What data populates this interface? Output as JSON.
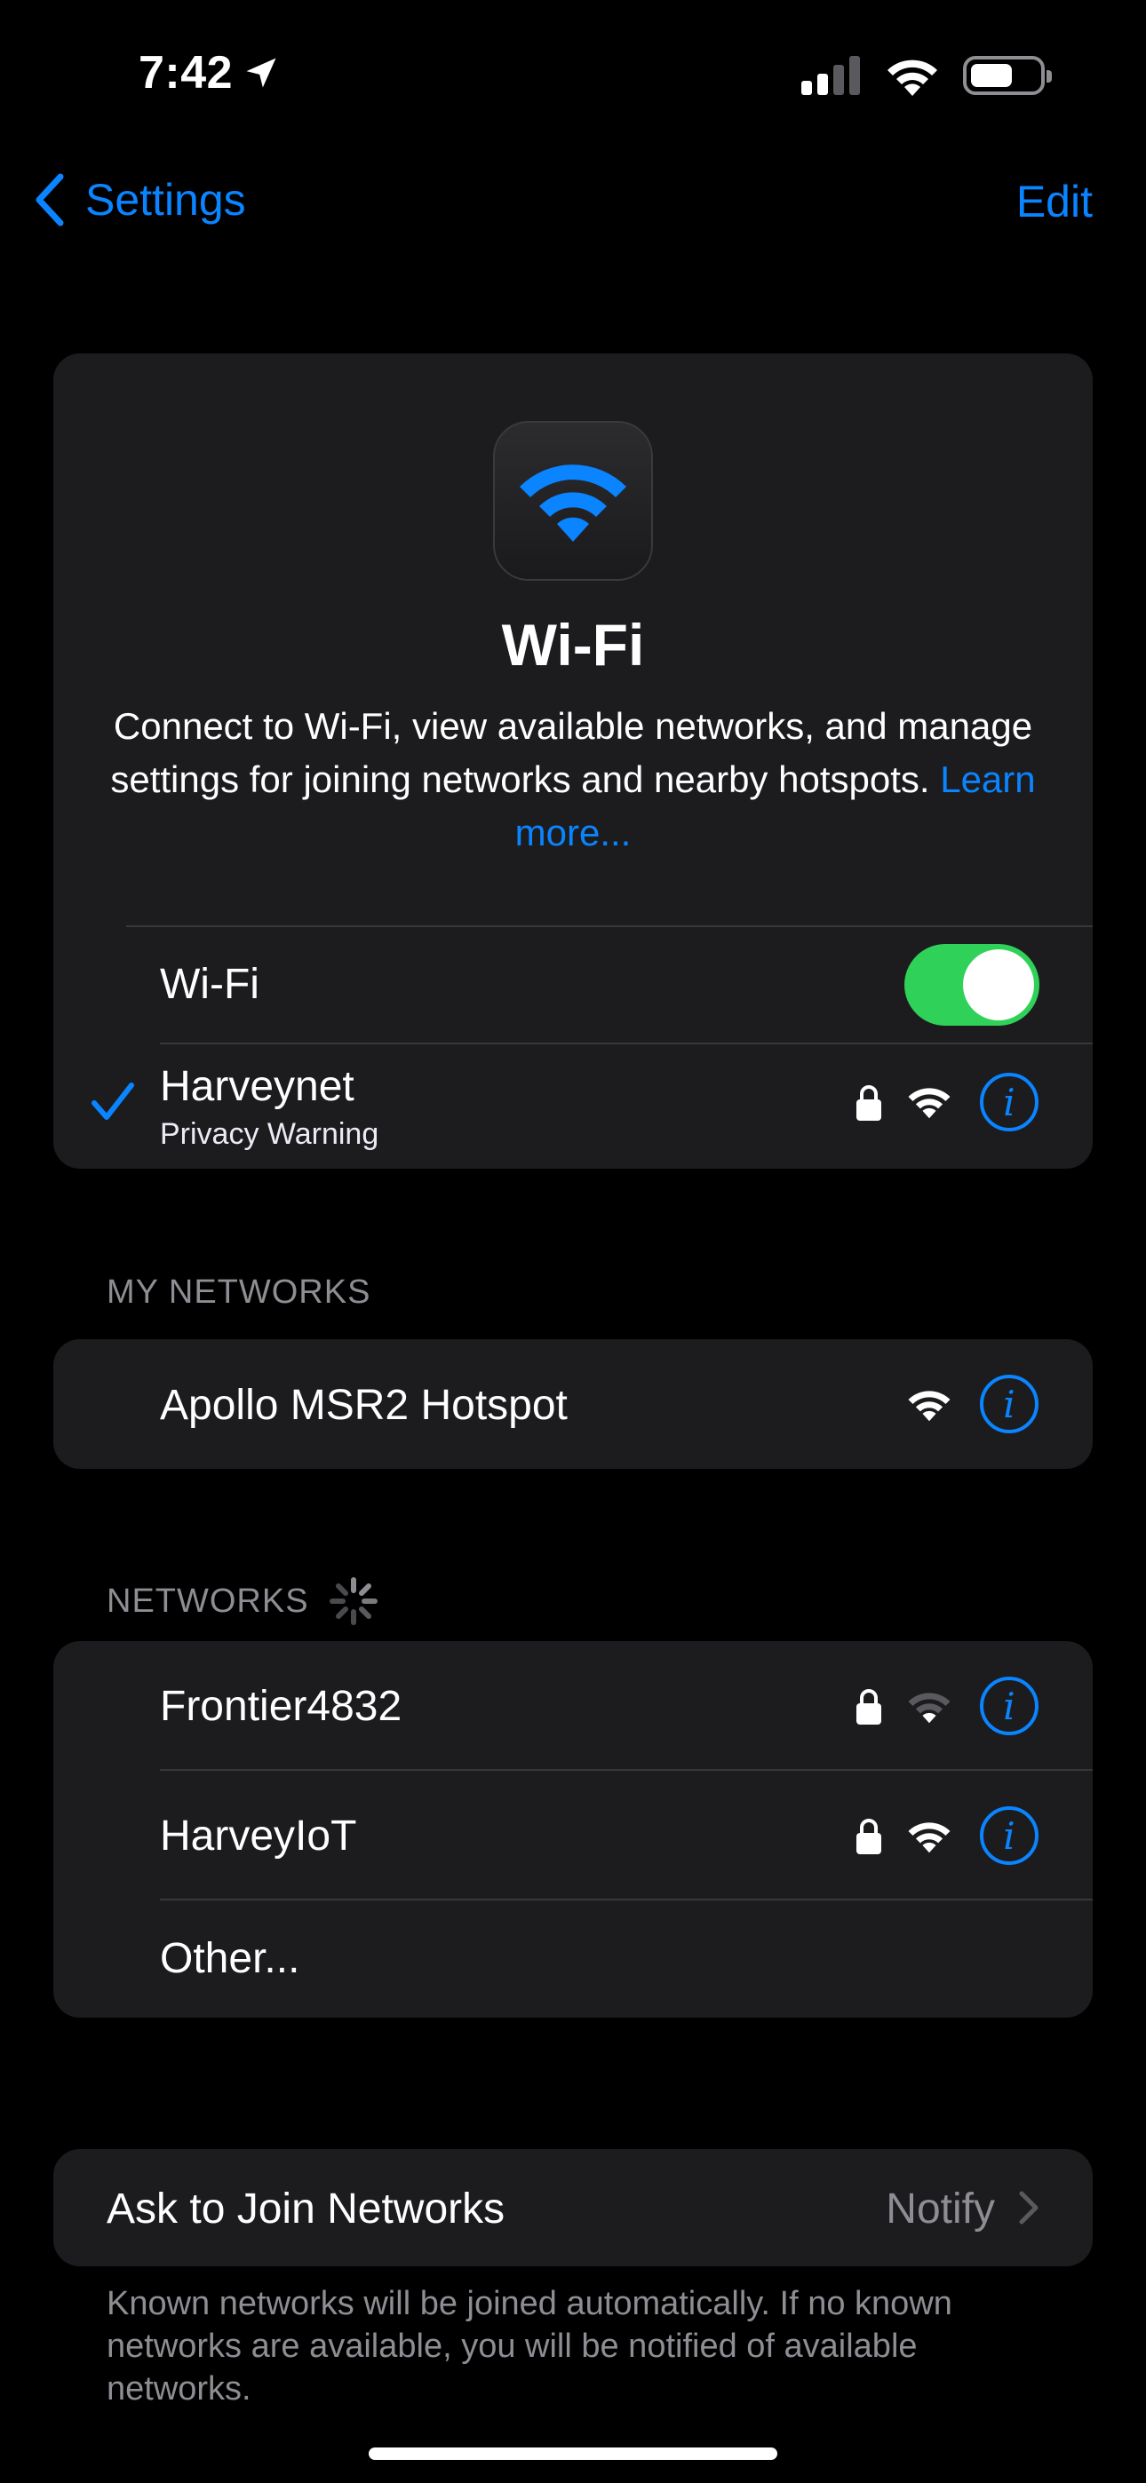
{
  "status_bar": {
    "time": "7:42"
  },
  "nav": {
    "back_label": "Settings",
    "edit_label": "Edit"
  },
  "hero": {
    "title": "Wi-Fi",
    "description": "Connect to Wi-Fi, view available networks, and manage settings for joining networks and nearby hotspots.",
    "learn_more": "Learn more..."
  },
  "wifi_toggle": {
    "label": "Wi-Fi",
    "on": true
  },
  "connected": {
    "name": "Harveynet",
    "subtitle": "Privacy Warning"
  },
  "my_networks": {
    "header": "MY NETWORKS",
    "items": [
      {
        "name": "Apollo MSR2 Hotspot"
      }
    ]
  },
  "networks": {
    "header": "NETWORKS",
    "items": [
      {
        "name": "Frontier4832"
      },
      {
        "name": "HarveyIoT"
      }
    ],
    "other": "Other..."
  },
  "ask_to_join": {
    "label": "Ask to Join Networks",
    "value": "Notify"
  },
  "footer_note": "Known networks will be joined automatically. If no known networks are available, you will be notified of available networks.",
  "colors": {
    "accent": "#0a84ff",
    "toggle_on": "#30d158",
    "card": "#1c1c1e",
    "background": "#000000"
  }
}
